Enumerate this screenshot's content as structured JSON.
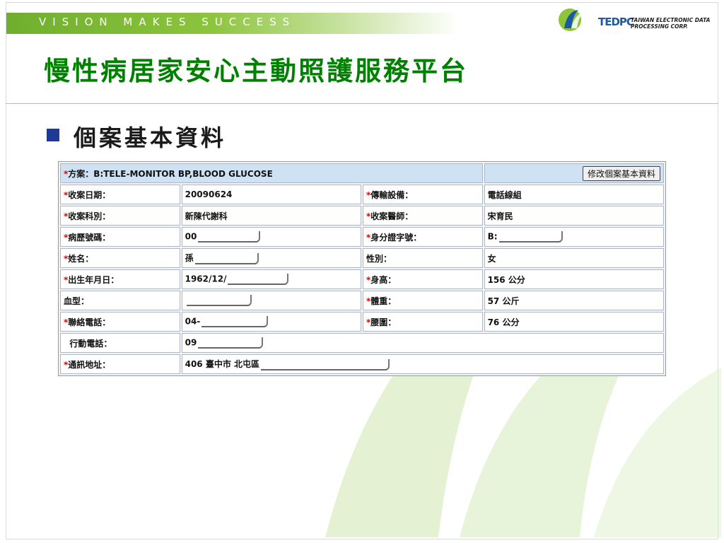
{
  "header": {
    "tagline": "VISION MAKES SUCCESS",
    "brand": "TEDPC",
    "company_line1": "TAIWAN ELECTRONIC DATA",
    "company_line2": "PROCESSING CORP.",
    "title": "慢性病居家安心主動照護服務平台"
  },
  "section": {
    "subtitle": "個案基本資料"
  },
  "form": {
    "plan_label": "方案：",
    "plan_value": "B:TELE-MONITOR BP,BLOOD GLUCOSE",
    "edit_button": "修改個案基本資料",
    "rows": [
      {
        "l1": "收案日期：",
        "v1": "20090624",
        "l2": "傳輸設備：",
        "v2": "電話線組"
      },
      {
        "l1": "收案科別：",
        "v1": "新陳代謝科",
        "l2": "收案醫師：",
        "v2": "宋育民"
      },
      {
        "l1": "病歷號碼：",
        "v1": "00",
        "l2": "身分證字號：",
        "v2": "B:"
      },
      {
        "l1": "姓名：",
        "v1": "孫",
        "l2": "性別：",
        "v2": "女"
      },
      {
        "l1": "出生年月日：",
        "v1": "1962/12/",
        "l2": "身高：",
        "v2": "156 公分"
      },
      {
        "l1": "血型：",
        "v1": "",
        "l2": "體重：",
        "v2": "57 公斤"
      },
      {
        "l1": "聯絡電話：",
        "v1": "04-",
        "l2": "腰圍：",
        "v2": "76 公分"
      }
    ],
    "mobile_label": "行動電話：",
    "mobile_value": "09",
    "address_label": "通訊地址：",
    "address_value": "406 臺中市 北屯區"
  }
}
